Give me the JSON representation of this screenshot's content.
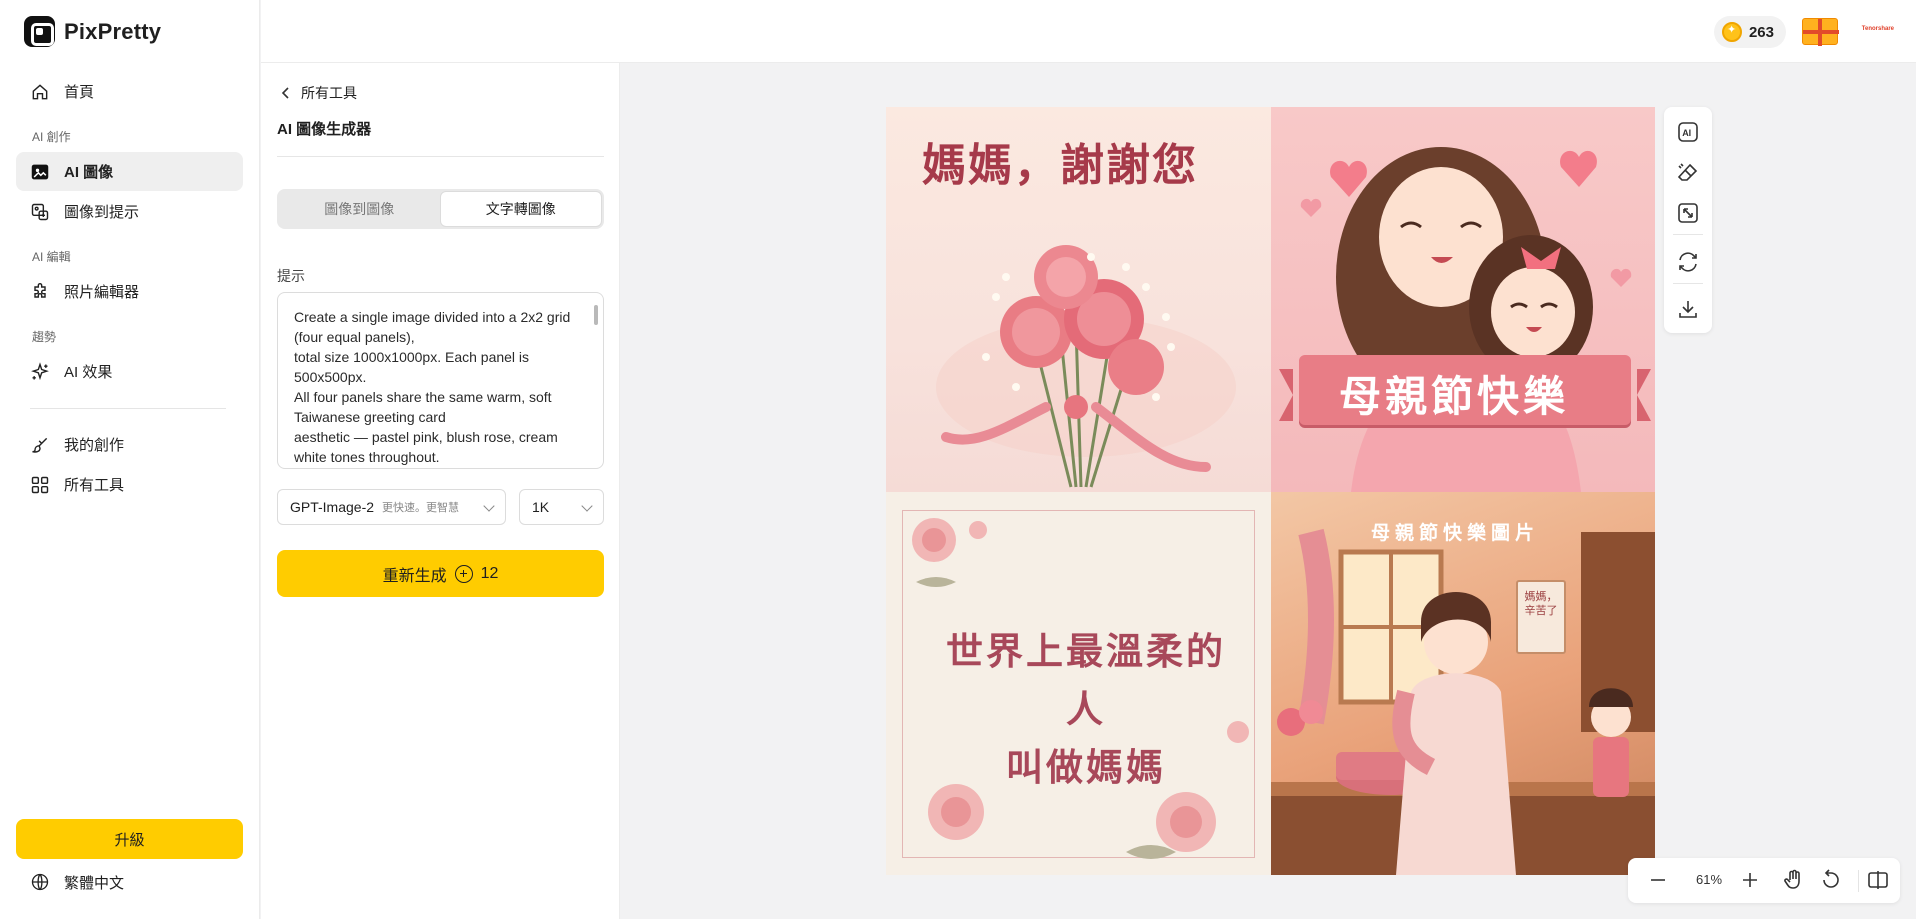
{
  "app": {
    "name": "PixPretty"
  },
  "sidebar": {
    "home": "首頁",
    "sections": {
      "ai_create": "AI 創作",
      "ai_edit": "AI 編輯",
      "trends": "趨勢"
    },
    "items": {
      "ai_image": "AI 圖像",
      "image_to_prompt": "圖像到提示",
      "photo_editor": "照片編輯器",
      "ai_effects": "AI 效果",
      "my_creations": "我的創作",
      "all_tools": "所有工具"
    },
    "upgrade": "升級",
    "language": "繁體中文"
  },
  "topbar": {
    "credits": "263",
    "brand_tag": "Tenorshare"
  },
  "panel": {
    "back_label": "所有工具",
    "title": "AI 圖像生成器",
    "tabs": [
      "圖像到圖像",
      "文字轉圖像"
    ],
    "active_tab": "文字轉圖像",
    "prompt_label": "提示",
    "prompt_text": "Create a single image divided into a 2x2 grid (four equal panels),\ntotal size 1000x1000px. Each panel is 500x500px.\nAll four panels share the same warm, soft Taiwanese greeting card\naesthetic — pastel pink, blush rose, cream white tones throughout.",
    "model": {
      "name": "GPT-Image-2",
      "hint": "更快速。更智慧"
    },
    "resolution": "1K",
    "generate_label": "重新生成",
    "generate_cost": "12"
  },
  "canvas": {
    "panels": {
      "p1_text": "媽媽，謝謝您",
      "p2_text": "母親節快樂",
      "p3_text": "世界上最溫柔的人\n叫做媽媽",
      "p4_title": "母親節快樂圖片",
      "p4_sign": "媽媽，\n辛苦了"
    },
    "zoom": "61%"
  },
  "colors": {
    "accent": "#ffcc00",
    "coin": "#ffc21a",
    "card_pink": "#f4b9bb",
    "card_text": "#a63a4a"
  }
}
